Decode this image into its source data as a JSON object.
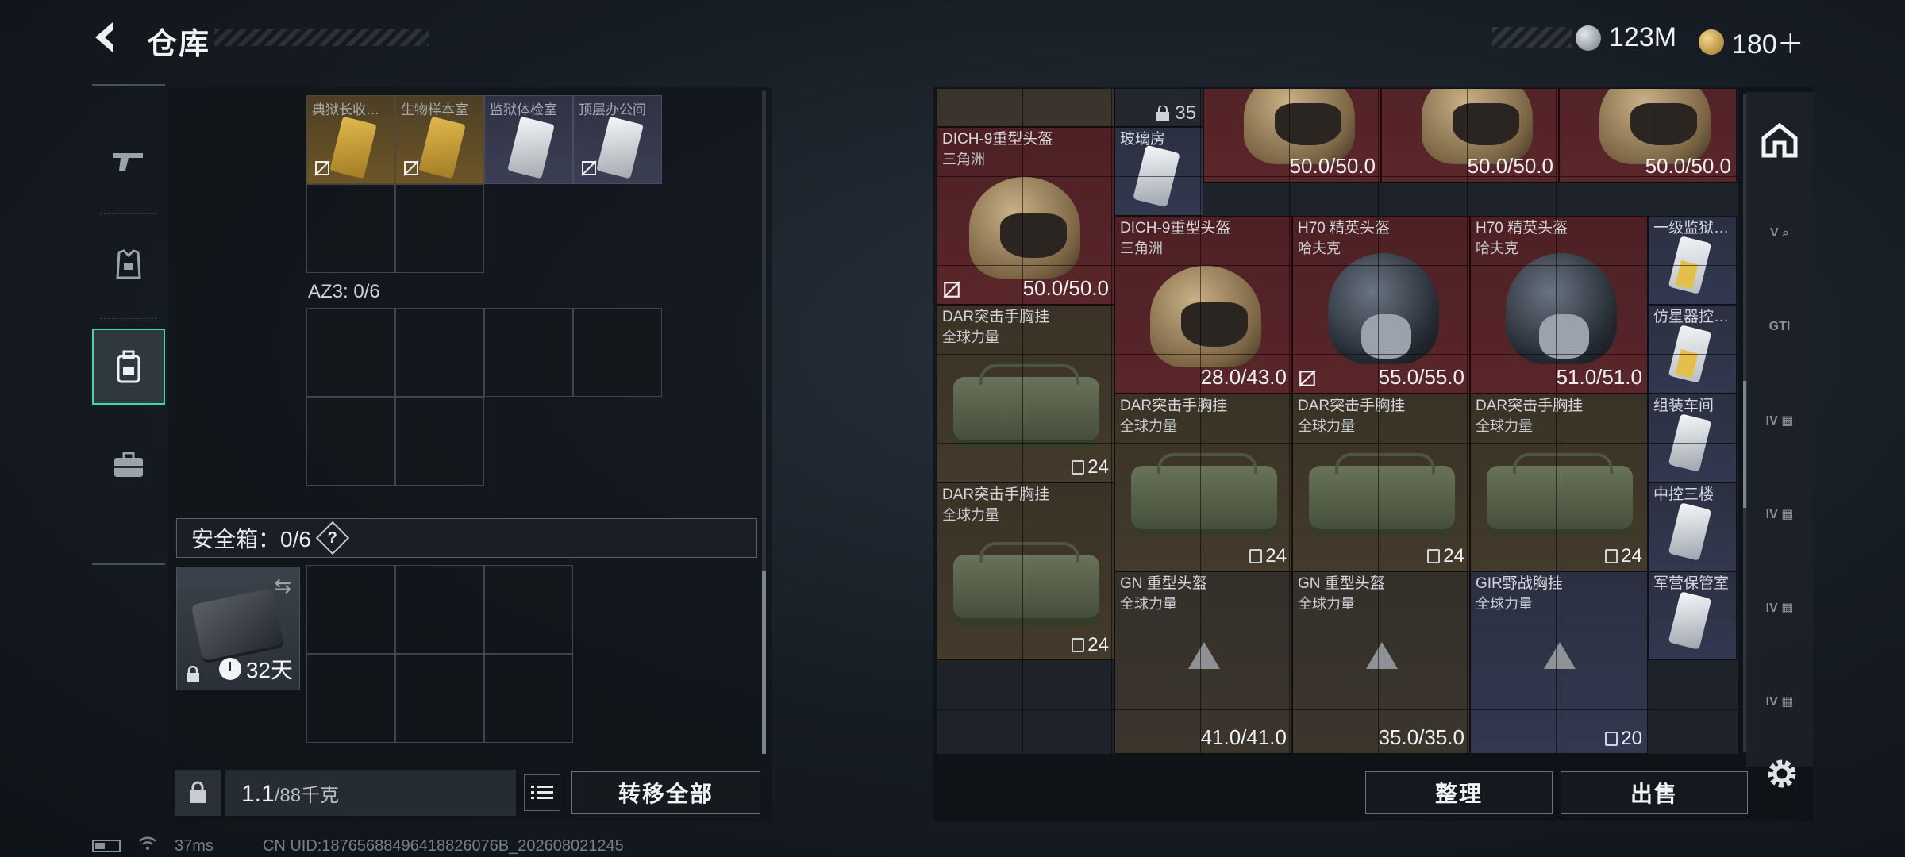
{
  "header": {
    "title": "仓库",
    "currency": [
      {
        "icon": "silver-coin-icon",
        "value": "123M"
      },
      {
        "icon": "gold-coin-icon",
        "value": "180＋"
      }
    ]
  },
  "side_tabs": [
    {
      "name": "weapons",
      "icon": "pistol-icon"
    },
    {
      "name": "armor",
      "icon": "armor-vest-icon"
    },
    {
      "name": "backpack",
      "icon": "backpack-icon",
      "active": true
    },
    {
      "name": "case",
      "icon": "briefcase-icon"
    }
  ],
  "left": {
    "keycards": [
      {
        "name": "典狱长收…",
        "color": "gold"
      },
      {
        "name": "生物样本室",
        "color": "gold"
      },
      {
        "name": "监狱体检室",
        "color": "white"
      },
      {
        "name": "顶层办公间",
        "color": "white"
      }
    ],
    "az3_label": "AZ3: 0/6",
    "safebox_label": "安全箱：0/6",
    "safebox_help": "?",
    "safebox_days": "32天",
    "weight_value": "1.1",
    "weight_capacity": "/88千克",
    "transfer_all": "转移全部"
  },
  "right": {
    "items": [
      {
        "id": "dich-helmet-a",
        "name": "DICH-9重型头盔",
        "sub": "三角洲",
        "dur": "50.0/50.0"
      },
      {
        "id": "glass-room",
        "name": "玻璃房"
      },
      {
        "id": "top-lock",
        "count": "35"
      },
      {
        "id": "top-helmet-1",
        "dur": "50.0/50.0"
      },
      {
        "id": "top-helmet-2",
        "dur": "50.0/50.0"
      },
      {
        "id": "top-helmet-3",
        "dur": "50.0/50.0"
      },
      {
        "id": "dich-helmet-b",
        "name": "DICH-9重型头盔",
        "sub": "三角洲",
        "dur": "28.0/43.0"
      },
      {
        "id": "h70-a",
        "name": "H70 精英头盔",
        "sub": "哈夫克",
        "dur": "55.0/55.0"
      },
      {
        "id": "h70-b",
        "name": "H70 精英头盔",
        "sub": "哈夫克",
        "dur": "51.0/51.0"
      },
      {
        "id": "card-level1",
        "name": "一级监狱…"
      },
      {
        "id": "card-simulator",
        "name": "仿星器控…"
      },
      {
        "id": "card-assembly",
        "name": "组装车间"
      },
      {
        "id": "card-central",
        "name": "中控三楼"
      },
      {
        "id": "card-barracks",
        "name": "军营保管室"
      },
      {
        "id": "dar-1",
        "name": "DAR突击手胸挂",
        "sub": "全球力量",
        "count": "24"
      },
      {
        "id": "dar-2",
        "name": "DAR突击手胸挂",
        "sub": "全球力量",
        "count": "24"
      },
      {
        "id": "dar-3",
        "name": "DAR突击手胸挂",
        "sub": "全球力量",
        "count": "24"
      },
      {
        "id": "dar-4",
        "name": "DAR突击手胸挂",
        "sub": "全球力量",
        "count": "24"
      },
      {
        "id": "dar-5",
        "name": "DAR突击手胸挂",
        "sub": "全球力量",
        "count": "24"
      },
      {
        "id": "gn-a",
        "name": "GN 重型头盔",
        "sub": "全球力量",
        "dur": "41.0/41.0"
      },
      {
        "id": "gn-b",
        "name": "GN 重型头盔",
        "sub": "全球力量",
        "dur": "35.0/35.0"
      },
      {
        "id": "gir",
        "name": "GIR野战胸挂",
        "sub": "全球力量",
        "count": "20"
      }
    ],
    "sort_button": "整理",
    "sell_button": "出售"
  },
  "right_icons": [
    {
      "icon": "building-icon"
    },
    {
      "icon": "v-card-icon",
      "label": "V"
    },
    {
      "icon": "gti-card-icon",
      "label": "GTI"
    },
    {
      "icon": "iv-card-icon",
      "label": "IV"
    },
    {
      "icon": "iv-card-icon",
      "label": "IV"
    },
    {
      "icon": "iv-card-icon",
      "label": "IV"
    },
    {
      "icon": "iv-card-icon",
      "label": "IV"
    }
  ],
  "status": {
    "ping": "37ms",
    "uid": "CN UID:18765688496418826076B_202608021245"
  }
}
